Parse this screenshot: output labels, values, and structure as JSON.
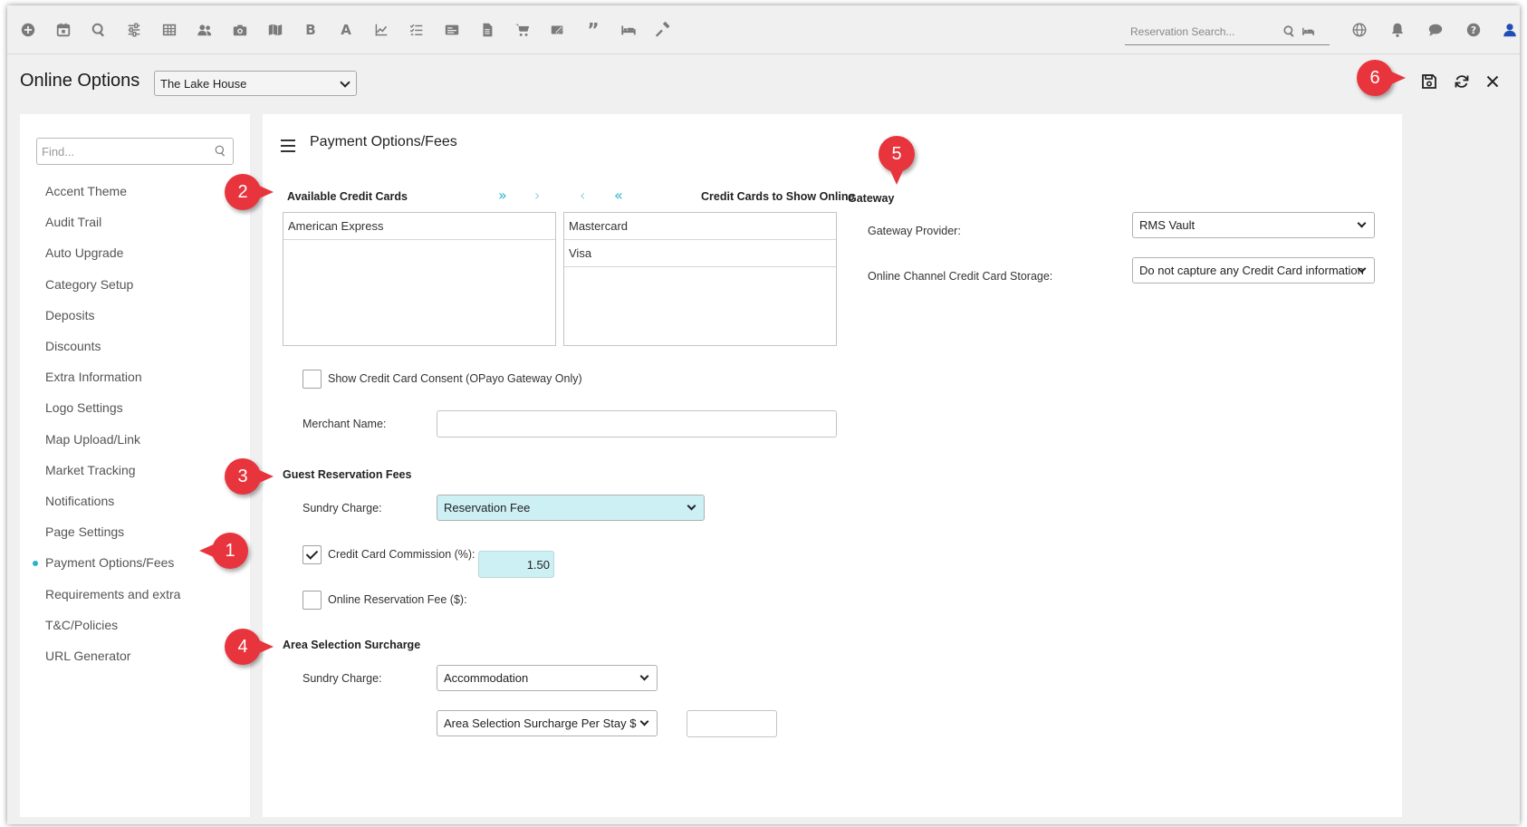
{
  "toolbar": {
    "icons": [
      "plus-circle-icon",
      "calendar-icon",
      "search-icon",
      "sliders-icon",
      "grid-icon",
      "users-icon",
      "camera-icon",
      "map-icon",
      "bold-b-icon",
      "font-a-icon",
      "line-chart-icon",
      "checklist-icon",
      "id-card-icon",
      "document-icon",
      "cart-icon",
      "tickets-icon",
      "quote-icon",
      "bed-icon",
      "hammer-icon"
    ],
    "search_placeholder": "Reservation Search...",
    "right_icons": [
      "globe-icon",
      "bell-icon",
      "chat-icon",
      "help-icon",
      "user-icon"
    ]
  },
  "header": {
    "title": "Online Options",
    "property_selected": "The Lake House"
  },
  "sidebar": {
    "find_placeholder": "Find...",
    "items": [
      {
        "label": "Accent Theme"
      },
      {
        "label": "Audit Trail"
      },
      {
        "label": "Auto Upgrade"
      },
      {
        "label": "Category Setup"
      },
      {
        "label": "Deposits"
      },
      {
        "label": "Discounts"
      },
      {
        "label": "Extra Information"
      },
      {
        "label": "Logo Settings"
      },
      {
        "label": "Map Upload/Link"
      },
      {
        "label": "Market Tracking"
      },
      {
        "label": "Notifications"
      },
      {
        "label": "Page Settings"
      },
      {
        "label": "Payment Options/Fees"
      },
      {
        "label": "Requirements and extra"
      },
      {
        "label": "T&C/Policies"
      },
      {
        "label": "URL Generator"
      }
    ],
    "active_index": 12
  },
  "main": {
    "section_title": "Payment Options/Fees",
    "available_cards_label": "Available Credit Cards",
    "show_online_label": "Credit Cards to Show Online",
    "available_cards": [
      "American Express"
    ],
    "show_online_cards": [
      "Mastercard",
      "Visa"
    ],
    "transfer_buttons": [
      "»",
      "›",
      "‹",
      "«"
    ],
    "consent_label": "Show Credit Card Consent (OPayo Gateway Only)",
    "consent_checked": false,
    "merchant_label": "Merchant Name:",
    "merchant_value": "",
    "guest_fees_heading": "Guest Reservation Fees",
    "sundry_label": "Sundry Charge:",
    "sundry_value": "Reservation Fee",
    "cc_commission_label": "Credit Card Commission (%):",
    "cc_commission_checked": true,
    "cc_commission_value": "1.50",
    "online_fee_label": "Online Reservation Fee ($):",
    "online_fee_checked": false,
    "area_heading": "Area Selection Surcharge",
    "area_sundry_label": "Sundry Charge:",
    "area_sundry_value": "Accommodation",
    "area_type_value": "Area Selection Surcharge Per Stay $",
    "area_amount_value": ""
  },
  "gateway": {
    "heading": "Gateway",
    "provider_label": "Gateway Provider:",
    "provider_value": "RMS Vault",
    "storage_label": "Online Channel Credit Card Storage:",
    "storage_value": "Do not capture any Credit Card information"
  },
  "callouts": [
    "1",
    "2",
    "3",
    "4",
    "5",
    "6"
  ],
  "colors": {
    "accent": "#2ab3c8",
    "callout": "#e8343c",
    "highlight_field": "#cdf0f5"
  }
}
